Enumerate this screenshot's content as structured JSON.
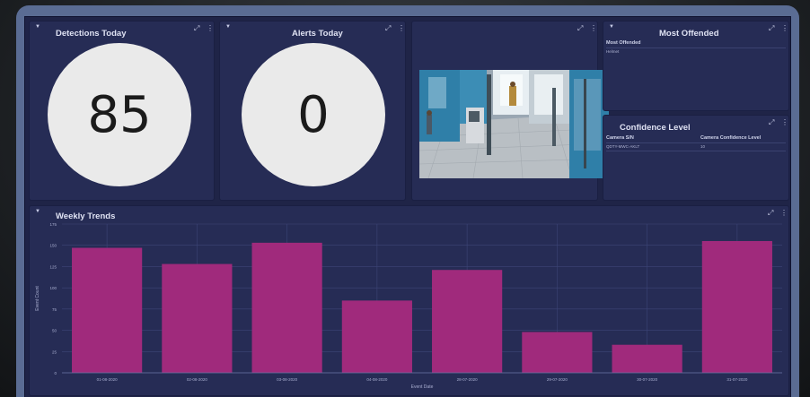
{
  "panels": {
    "detections": {
      "title": "Detections Today",
      "value": "85"
    },
    "alerts": {
      "title": "Alerts Today",
      "value": "0"
    },
    "most_offended": {
      "title": "Most Offended",
      "header": "Most Offended",
      "item": "Helmet"
    },
    "confidence": {
      "title": "Confidence Level",
      "col1": "Camera S/N",
      "col2": "Camera Confidence Level",
      "row_sn": "QDTY-MWC-AKLT",
      "row_level": "10"
    },
    "weekly": {
      "title": "Weekly Trends"
    }
  },
  "icons": {
    "filter": "filter-icon",
    "expand": "expand-icon",
    "more": "more-vertical-icon"
  },
  "colors": {
    "bar": "#a02a7c",
    "panel": "#262c55",
    "frame": "#5a6c93"
  },
  "chart_data": {
    "type": "bar",
    "title": "Weekly Trends",
    "categories": [
      "01-08-2020",
      "02-08-2020",
      "03-08-2020",
      "04-08-2020",
      "28-07-2020",
      "29-07-2020",
      "30-07-2020",
      "31-07-2020"
    ],
    "values": [
      147,
      128,
      153,
      85,
      121,
      48,
      33,
      155
    ],
    "xlabel": "Event Date",
    "ylabel": "Event Count",
    "yticks": [
      "0",
      "25",
      "50",
      "75",
      "100",
      "125",
      "150",
      "175"
    ],
    "ylim": [
      0,
      175
    ],
    "grid": true
  }
}
